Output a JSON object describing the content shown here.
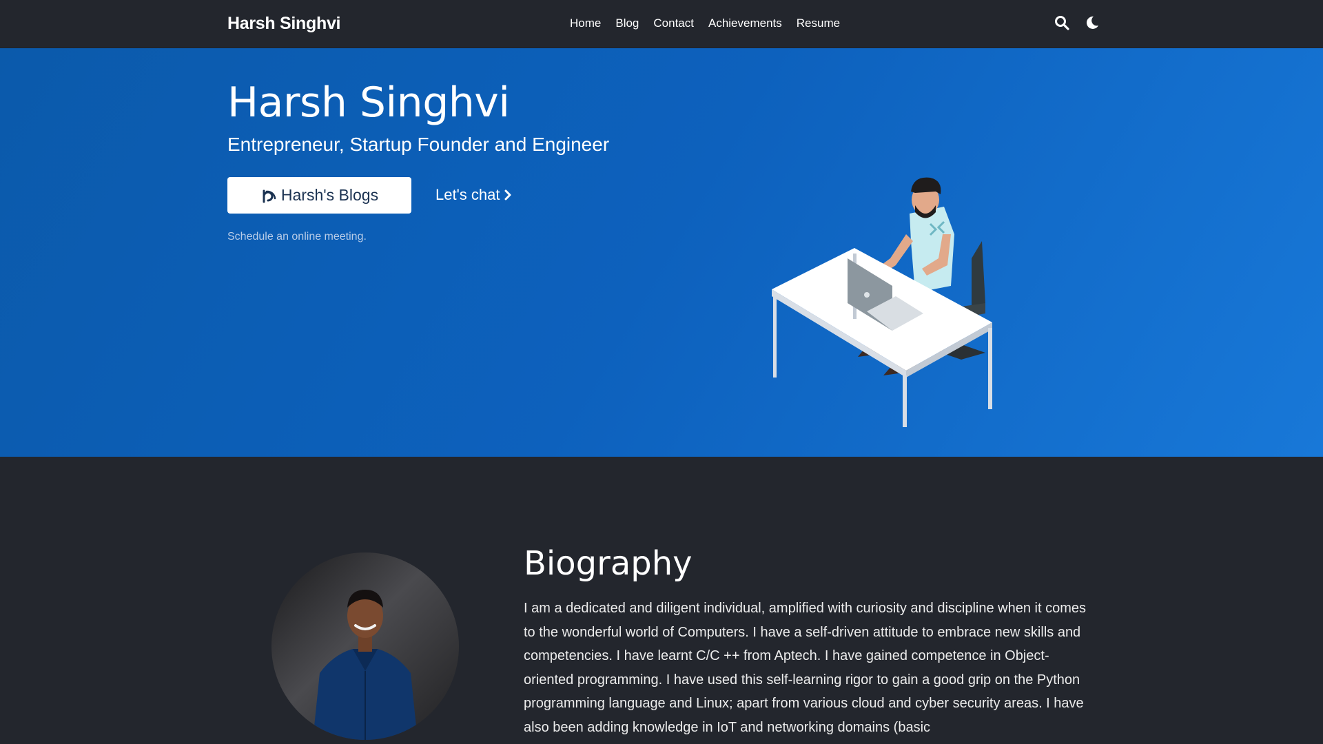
{
  "nav": {
    "brand": "Harsh Singhvi",
    "links": [
      "Home",
      "Blog",
      "Contact",
      "Achievements",
      "Resume"
    ],
    "icons": [
      "search-icon",
      "moon-icon"
    ]
  },
  "hero": {
    "title": "Harsh Singhvi",
    "subtitle": "Entrepreneur, Startup Founder and Engineer",
    "blogs_button": "Harsh's Blogs",
    "chat_link": "Let's chat",
    "note": "Schedule an online meeting."
  },
  "bio": {
    "title": "Biography",
    "text": "I am a dedicated and diligent individual, amplified with curiosity and discipline when it comes to the wonderful world of Computers. I have a self-driven attitude to embrace new skills and competencies. I have learnt C/C ++ from Aptech. I have gained competence in Object-oriented programming. I have used this self-learning rigor to gain a good grip on the Python programming language and Linux; apart from various cloud and cyber security areas. I have also been adding knowledge in IoT and networking domains (basic"
  },
  "colors": {
    "page_bg": "#23262d",
    "hero_gradient_start": "#0b5aab",
    "hero_gradient_end": "#1878d8",
    "button_text": "#1b3251"
  }
}
